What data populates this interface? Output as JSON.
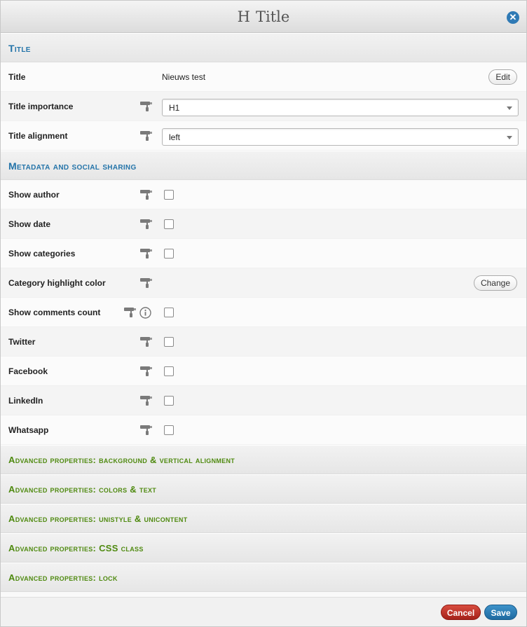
{
  "dialog": {
    "title_glyph": "H",
    "title": "Title",
    "close_icon": "close-circle-icon"
  },
  "sections": {
    "title": {
      "header": "Title",
      "title_row": {
        "label": "Title",
        "value": "Nieuws test",
        "button": "Edit"
      },
      "importance_row": {
        "label": "Title importance",
        "selected": "H1"
      },
      "alignment_row": {
        "label": "Title alignment",
        "selected": "left"
      }
    },
    "metadata": {
      "header": "Metadata and social sharing",
      "rows": [
        {
          "label": "Show author"
        },
        {
          "label": "Show date"
        },
        {
          "label": "Show categories"
        },
        {
          "label": "Category highlight color",
          "button": "Change"
        },
        {
          "label": "Show comments count"
        },
        {
          "label": "Twitter"
        },
        {
          "label": "Facebook"
        },
        {
          "label": "LinkedIn"
        },
        {
          "label": "Whatsapp"
        }
      ]
    },
    "advanced": [
      "Advanced properties: background & vertical alignment",
      "Advanced properties: colors & text",
      "Advanced properties: unistyle & unicontent",
      "Advanced properties: CSS class",
      "Advanced properties: lock"
    ]
  },
  "footer": {
    "cancel_label": "Cancel",
    "save_label": "Save"
  },
  "colors": {
    "section_blue": "#2474a9",
    "section_green": "#4f8a10",
    "cancel": "#b8322a",
    "save": "#2a7db8"
  }
}
